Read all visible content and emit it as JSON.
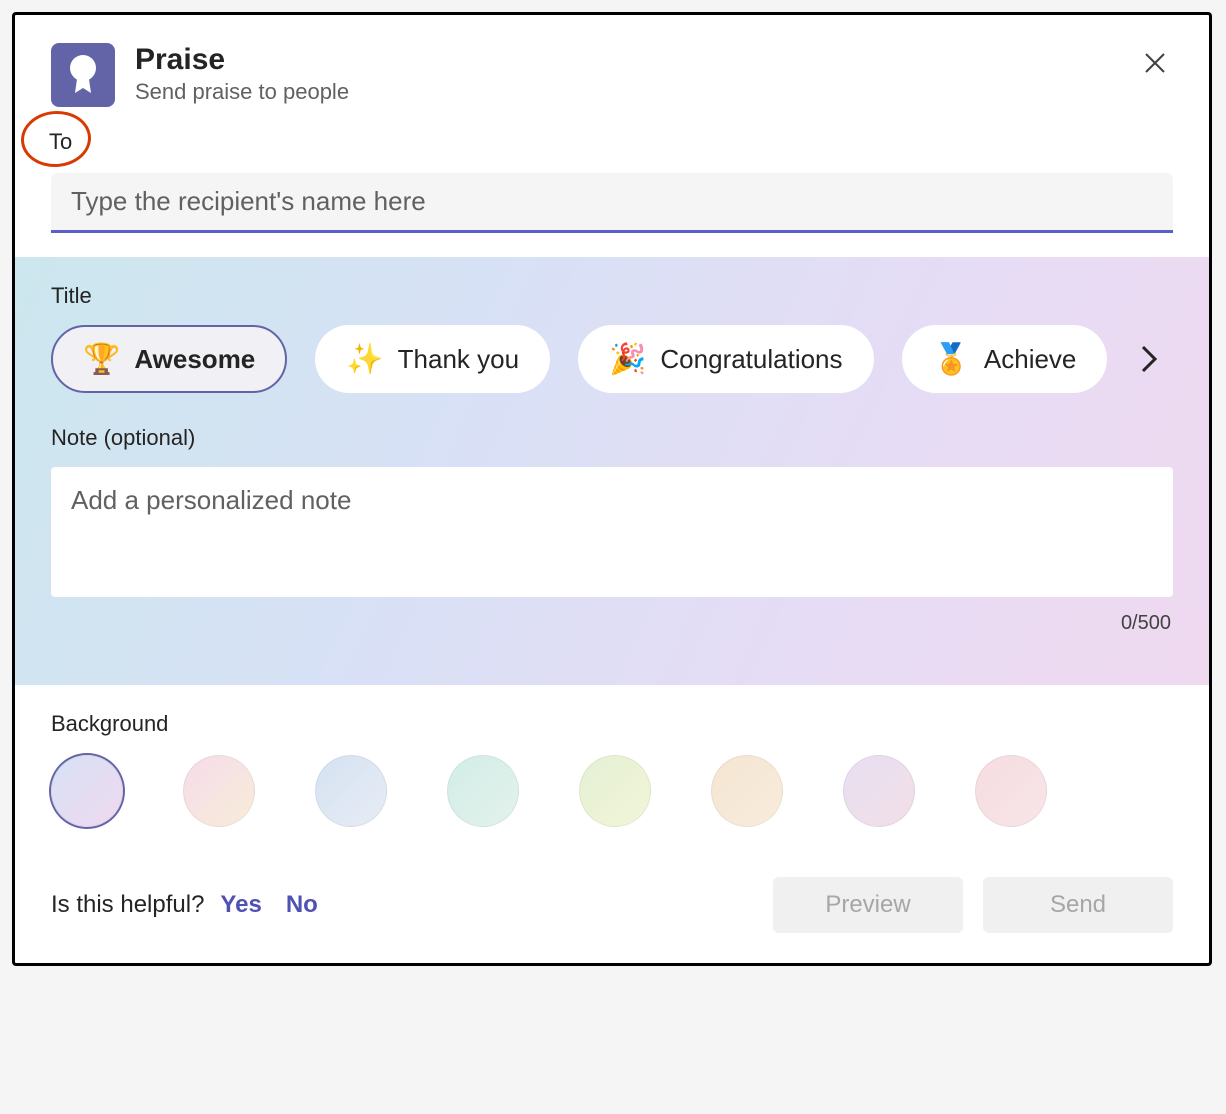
{
  "header": {
    "title": "Praise",
    "subtitle": "Send praise to people"
  },
  "to": {
    "label": "To",
    "placeholder": "Type the recipient's name here"
  },
  "titleSection": {
    "label": "Title",
    "chips": [
      {
        "emoji": "🏆",
        "label": "Awesome",
        "selected": true
      },
      {
        "emoji": "✨",
        "label": "Thank you",
        "selected": false
      },
      {
        "emoji": "🎉",
        "label": "Congratulations",
        "selected": false
      },
      {
        "emoji": "🏅",
        "label": "Achieve",
        "selected": false
      }
    ]
  },
  "note": {
    "label": "Note (optional)",
    "placeholder": "Add a personalized note",
    "counter": "0/500"
  },
  "background": {
    "label": "Background"
  },
  "footer": {
    "question": "Is this helpful?",
    "yes": "Yes",
    "no": "No",
    "preview": "Preview",
    "send": "Send"
  }
}
